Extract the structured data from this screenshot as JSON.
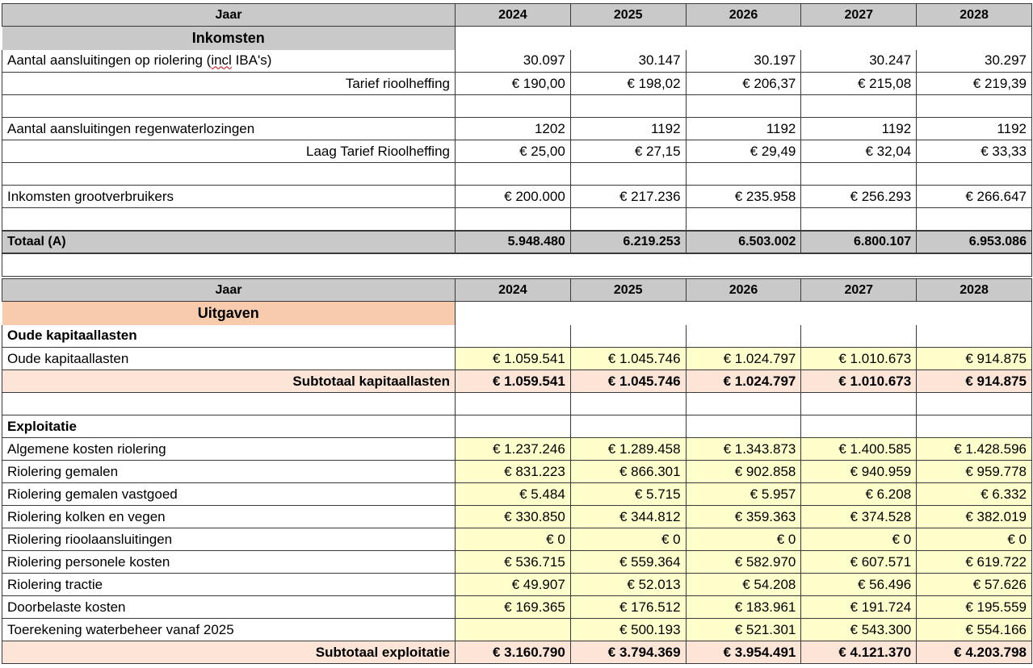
{
  "years": [
    "2024",
    "2025",
    "2026",
    "2027",
    "2028"
  ],
  "jaar_label": "Jaar",
  "inkomsten": {
    "title": "Inkomsten",
    "rows": [
      {
        "label": "Aantal aansluitingen op riolering (incl IBA's)",
        "align": "left",
        "values": [
          "30.097",
          "30.147",
          "30.197",
          "30.247",
          "30.297"
        ]
      },
      {
        "label": "Tarief rioolheffing",
        "align": "right",
        "values": [
          "€ 190,00",
          "€ 198,02",
          "€ 206,37",
          "€ 215,08",
          "€ 219,39"
        ]
      },
      {
        "label": "",
        "align": "left",
        "values": [
          "",
          "",
          "",
          "",
          ""
        ]
      },
      {
        "label": "Aantal aansluitingen regenwaterlozingen",
        "align": "left",
        "values": [
          "1202",
          "1192",
          "1192",
          "1192",
          "1192"
        ]
      },
      {
        "label": "Laag Tarief Rioolheffing",
        "align": "right",
        "values": [
          "€ 25,00",
          "€ 27,15",
          "€ 29,49",
          "€ 32,04",
          "€ 33,33"
        ]
      },
      {
        "label": "",
        "align": "left",
        "values": [
          "",
          "",
          "",
          "",
          ""
        ]
      },
      {
        "label": "Inkomsten grootverbruikers",
        "align": "left",
        "values": [
          "€ 200.000",
          "€ 217.236",
          "€ 235.958",
          "€ 256.293",
          "€ 266.647"
        ]
      },
      {
        "label": "",
        "align": "left",
        "values": [
          "",
          "",
          "",
          "",
          ""
        ]
      }
    ],
    "total": {
      "label": "Totaal (A)",
      "values": [
        "5.948.480",
        "6.219.253",
        "6.503.002",
        "6.800.107",
        "6.953.086"
      ]
    }
  },
  "uitgaven": {
    "title": "Uitgaven",
    "kapitaal_head": "Oude kapitaallasten",
    "kapitaal_rows": [
      {
        "label": "Oude kapitaallasten",
        "values": [
          "€ 1.059.541",
          "€ 1.045.746",
          "€ 1.024.797",
          "€ 1.010.673",
          "€ 914.875"
        ]
      }
    ],
    "kapitaal_subtotal": {
      "label": "Subtotaal kapitaallasten",
      "values": [
        "€ 1.059.541",
        "€ 1.045.746",
        "€ 1.024.797",
        "€ 1.010.673",
        "€ 914.875"
      ]
    },
    "exploitatie_head": "Exploitatie",
    "exploitatie_rows": [
      {
        "label": "Algemene kosten riolering",
        "values": [
          "€ 1.237.246",
          "€ 1.289.458",
          "€ 1.343.873",
          "€ 1.400.585",
          "€ 1.428.596"
        ]
      },
      {
        "label": "Riolering gemalen",
        "values": [
          "€ 831.223",
          "€ 866.301",
          "€ 902.858",
          "€ 940.959",
          "€ 959.778"
        ]
      },
      {
        "label": "Riolering gemalen vastgoed",
        "values": [
          "€ 5.484",
          "€ 5.715",
          "€ 5.957",
          "€ 6.208",
          "€ 6.332"
        ]
      },
      {
        "label": "Riolering kolken en vegen",
        "values": [
          "€ 330.850",
          "€ 344.812",
          "€ 359.363",
          "€ 374.528",
          "€ 382.019"
        ]
      },
      {
        "label": "Riolering rioolaansluitingen",
        "values": [
          "€ 0",
          "€ 0",
          "€ 0",
          "€ 0",
          "€ 0"
        ]
      },
      {
        "label": "Riolering personele kosten",
        "values": [
          "€ 536.715",
          "€ 559.364",
          "€ 582.970",
          "€ 607.571",
          "€ 619.722"
        ]
      },
      {
        "label": "Riolering tractie",
        "values": [
          "€ 49.907",
          "€ 52.013",
          "€ 54.208",
          "€ 56.496",
          "€ 57.626"
        ]
      },
      {
        "label": "Doorbelaste kosten",
        "values": [
          "€ 169.365",
          "€ 176.512",
          "€ 183.961",
          "€ 191.724",
          "€ 195.559"
        ]
      },
      {
        "label": "Toerekening waterbeheer vanaf 2025",
        "values": [
          "",
          "€ 500.193",
          "€ 521.301",
          "€ 543.300",
          "€ 554.166"
        ]
      }
    ],
    "exploitatie_subtotal": {
      "label": "Subtotaal exploitatie",
      "values": [
        "€ 3.160.790",
        "€ 3.794.369",
        "€ 3.954.491",
        "€ 4.121.370",
        "€ 4.203.798"
      ]
    }
  }
}
